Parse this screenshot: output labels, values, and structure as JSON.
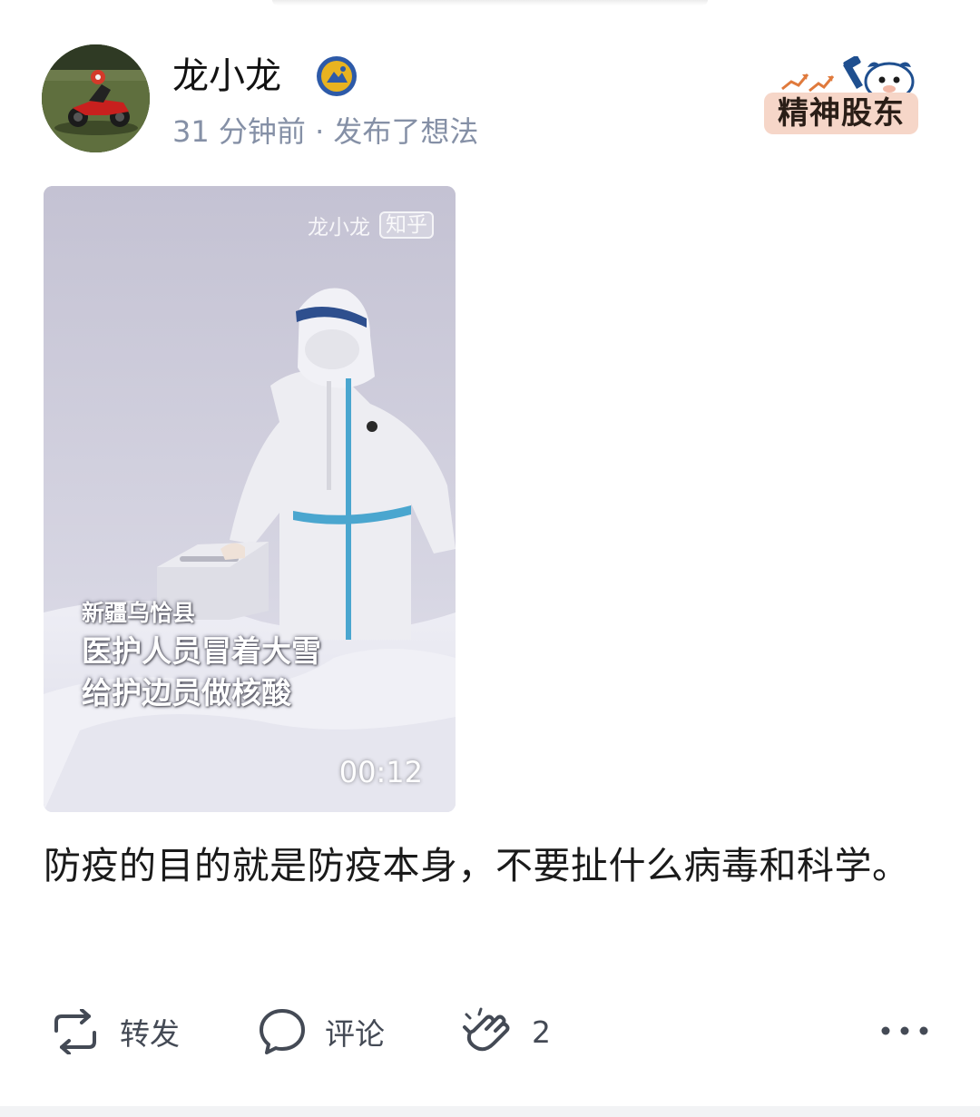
{
  "header": {
    "author_name": "龙小龙",
    "post_meta": "31 分钟前 · 发布了想法",
    "avatar_icon": "motorcycle-rider-avatar",
    "verified_icon": "verified-badge-icon",
    "sticker_label": "精神股东"
  },
  "video": {
    "watermark_author": "龙小龙",
    "watermark_logo": "知乎",
    "caption_line1": "新疆乌恰县",
    "caption_line2": "医护人员冒着大雪",
    "caption_line3": "给护边员做核酸",
    "duration": "00:12"
  },
  "post": {
    "text": "防疫的目的就是防疫本身，不要扯什么病毒和科学。"
  },
  "actions": {
    "repost_label": "转发",
    "comment_label": "评论",
    "clap_count": "2"
  },
  "colors": {
    "name_text": "#121212",
    "meta_text": "#8590a6",
    "action_text": "#444a55",
    "sticker_bg": "#f6d6c8",
    "badge_gold": "#e8b320",
    "badge_blue": "#2d5aa8"
  }
}
